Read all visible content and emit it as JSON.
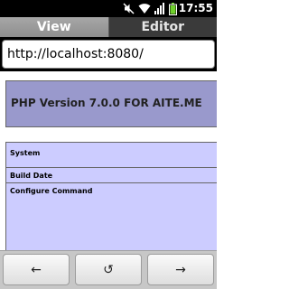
{
  "status_bar": {
    "time": "17:55",
    "icons": [
      "mute-icon",
      "wifi-icon",
      "signal-icon",
      "battery-icon"
    ]
  },
  "tabs": [
    {
      "label": "View",
      "active": true
    },
    {
      "label": "Editor",
      "active": false
    }
  ],
  "url_bar": {
    "value": "http://localhost:8080/"
  },
  "page": {
    "title": "PHP Version 7.0.0 FOR AITE.ME",
    "rows": [
      {
        "label": "System"
      },
      {
        "label": "Build Date"
      },
      {
        "label": "Configure Command"
      }
    ]
  },
  "navigation": {
    "back_icon": "←",
    "reload_icon": "↺",
    "forward_icon": "→"
  },
  "colors": {
    "php_header": "#9999cc",
    "php_row": "#ccccff"
  }
}
